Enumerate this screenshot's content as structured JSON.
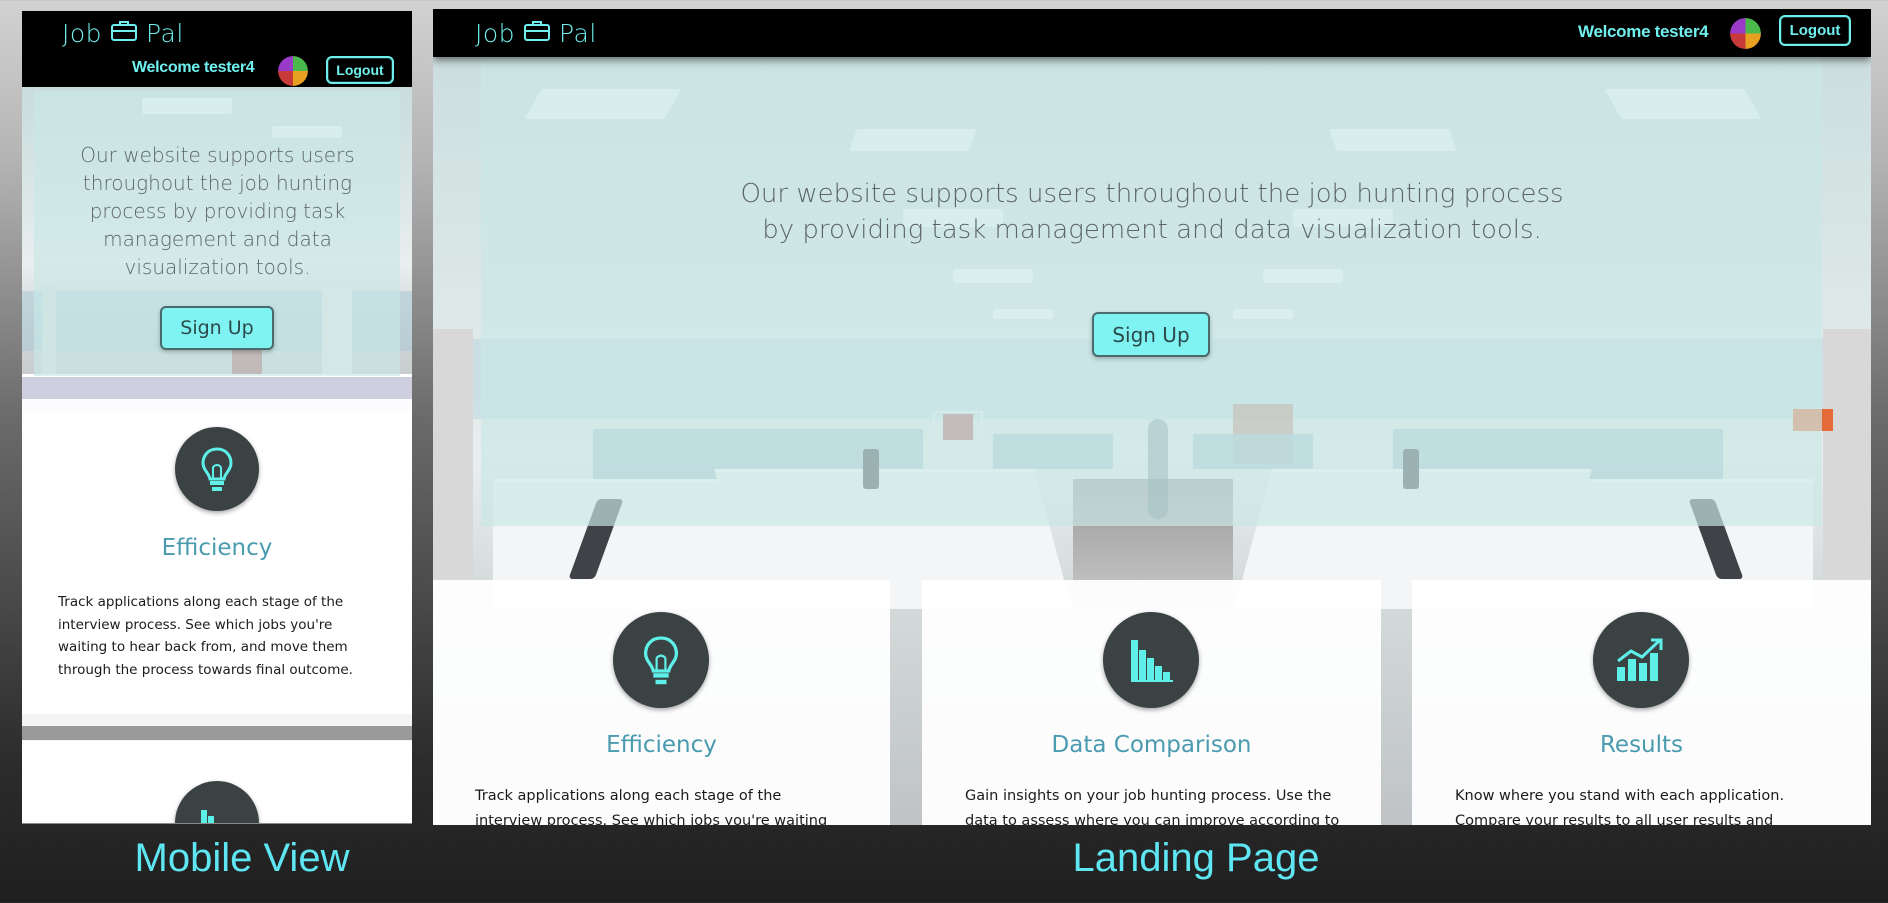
{
  "brand": {
    "logo_left": "Job",
    "logo_right": "Pal"
  },
  "user": {
    "welcome": "Welcome tester4"
  },
  "nav": {
    "logout_label": "Logout"
  },
  "hero": {
    "tagline": "Our website supports users throughout the job hunting process by providing task management and data visualization tools.",
    "signup_label": "Sign Up"
  },
  "features": [
    {
      "title": "Efficiency",
      "icon": "lightbulb-icon",
      "body": "Track applications along each stage of the interview process. See which jobs you're waiting to hear back from, and move them through the process towards final outcome."
    },
    {
      "title": "Data Comparison",
      "icon": "bar-chart-icon",
      "body": "Gain insights on your job hunting process. Use the data to assess where you can improve according to the data"
    },
    {
      "title": "Results",
      "icon": "trend-chart-icon",
      "body": "Know where you stand with each application. Compare your results to all user results and averages. Realize"
    }
  ],
  "captions": {
    "mobile": "Mobile View",
    "landing": "Landing Page"
  },
  "colors": {
    "accent": "#6ff0ee",
    "button": "#7ef3f1",
    "title": "#4a9ab0",
    "icon_bg": "#3a4244"
  }
}
